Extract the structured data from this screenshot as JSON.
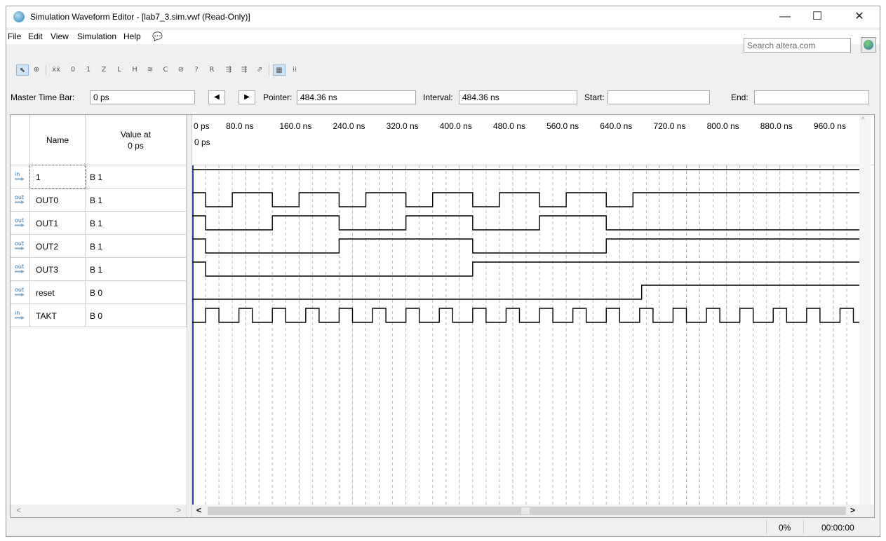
{
  "window": {
    "title": "Simulation Waveform Editor - [lab7_3.sim.vwf (Read-Only)]",
    "minimize": "—",
    "maximize": "☐",
    "close": "✕"
  },
  "menu": [
    "File",
    "Edit",
    "View",
    "Simulation",
    "Help"
  ],
  "search": {
    "placeholder": "Search altera.com"
  },
  "timebar": {
    "master_label": "Master Time Bar:",
    "master_value": "0 ps",
    "pointer_label": "Pointer:",
    "pointer_value": "484.36 ns",
    "interval_label": "Interval:",
    "interval_value": "484.36 ns",
    "start_label": "Start:",
    "start_value": "",
    "end_label": "End:",
    "end_value": ""
  },
  "columns": {
    "name": "Name",
    "value_line1": "Value at",
    "value_line2": "0 ps"
  },
  "cursor_label": "0 ps",
  "time_ticks": [
    "0 ps",
    "80.0 ns",
    "160.0 ns",
    "240.0 ns",
    "320.0 ns",
    "400.0 ns",
    "480.0 ns",
    "560.0 ns",
    "640.0 ns",
    "720.0 ns",
    "800.0 ns",
    "880.0 ns",
    "960.0 ns"
  ],
  "time_range_ns": [
    0,
    1000
  ],
  "signals": [
    {
      "dir": "in",
      "name": "1",
      "value": "B 1",
      "initial": 1,
      "transitions_ns": []
    },
    {
      "dir": "out",
      "name": "OUT0",
      "value": "B 1",
      "initial": 1,
      "transitions_ns": [
        20,
        60,
        120,
        160,
        220,
        260,
        320,
        360,
        420,
        460,
        520,
        560,
        620,
        660
      ]
    },
    {
      "dir": "out",
      "name": "OUT1",
      "value": "B 1",
      "initial": 1,
      "transitions_ns": [
        20,
        120,
        220,
        320,
        420,
        520,
        620
      ]
    },
    {
      "dir": "out",
      "name": "OUT2",
      "value": "B 1",
      "initial": 1,
      "transitions_ns": [
        20,
        220,
        420,
        620
      ]
    },
    {
      "dir": "out",
      "name": "OUT3",
      "value": "B 1",
      "initial": 1,
      "transitions_ns": [
        20,
        420
      ]
    },
    {
      "dir": "out",
      "name": "reset",
      "value": "B 0",
      "initial": 0,
      "transitions_ns": [
        673
      ]
    },
    {
      "dir": "in",
      "name": "TAKT",
      "value": "B 0",
      "initial": 0,
      "period_ns": 50,
      "first_rise_ns": 20,
      "high_ns": 20
    }
  ],
  "status": {
    "progress": "0%",
    "elapsed": "00:00:00"
  },
  "colors": {
    "waveform": "#000000",
    "grid": "#b8b8b8",
    "cursor": "#2b3fb0"
  }
}
